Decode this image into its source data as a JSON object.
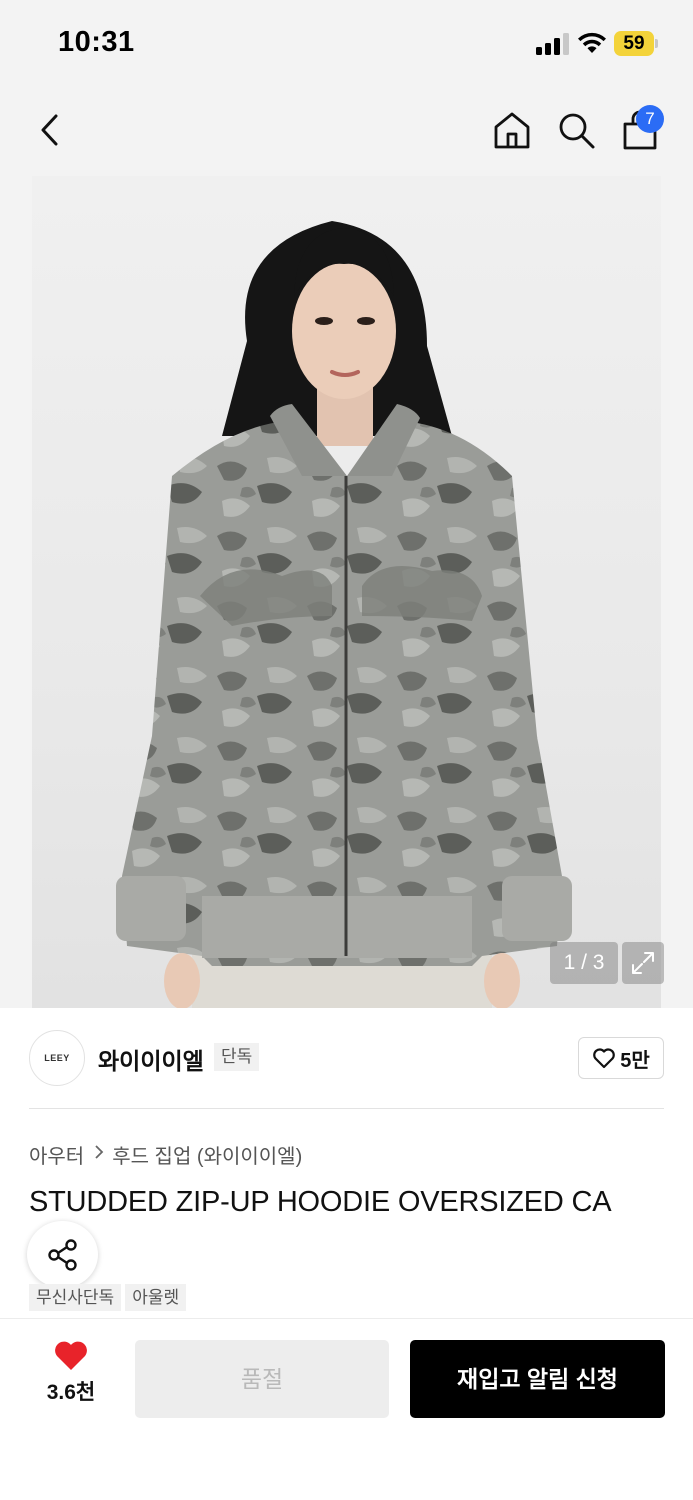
{
  "status_bar": {
    "time": "10:31",
    "battery": "59",
    "battery_color": "#f3d33a"
  },
  "nav": {
    "back_icon": "chevron-left-icon",
    "home_icon": "home-icon",
    "search_icon": "search-icon",
    "cart_icon": "shopping-bag-icon",
    "cart_count": "7",
    "badge_color": "#2b6cf5"
  },
  "gallery": {
    "page_indicator": "1 / 3",
    "expand_icon": "expand-icon"
  },
  "brand": {
    "logo_text": "LEEY",
    "name": "와이이이엘",
    "tag": "단독",
    "like_icon": "heart-outline-icon",
    "like_count": "5만"
  },
  "product": {
    "breadcrumb": [
      "아우터",
      "후드 집업 (와이이이엘)"
    ],
    "title": "STUDDED ZIP-UP HOODIE OVERSIZED CA",
    "tags": [
      "무신사단독",
      "아울렛"
    ],
    "share_icon": "share-icon"
  },
  "bottom_bar": {
    "wish_icon": "heart-filled-icon",
    "wish_color": "#e8232a",
    "wish_count": "3.6천",
    "soldout_label": "품절",
    "restock_label": "재입고 알림 신청"
  }
}
